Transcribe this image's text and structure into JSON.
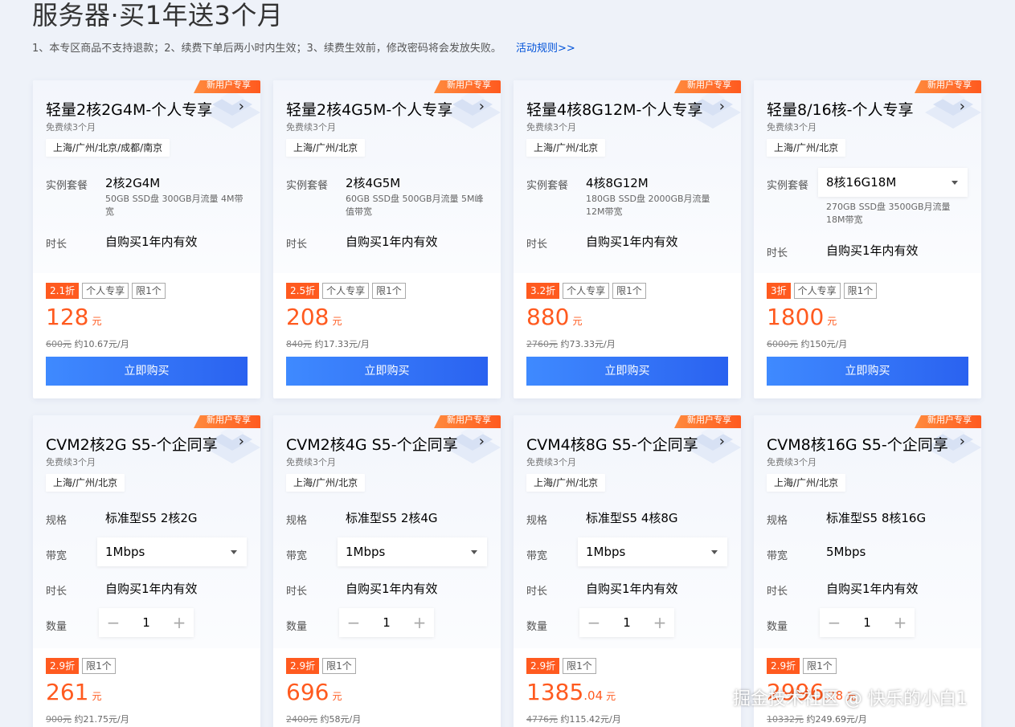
{
  "header": {
    "title": "服务器·买1年送3个月",
    "notice": "1、本专区商品不支持退款；2、续费下单后两小时内生效；3、续费生效前，修改密码将会发放失败。",
    "rules_link": "活动规则>>"
  },
  "cards": [
    {
      "badge": "新用户专享",
      "title": "轻量2核2G4M-个人专享",
      "subtitle": "免费续3个月",
      "region": "上海/广州/北京/成都/南京",
      "spec_label": "实例套餐",
      "spec_value": "2核2G4M",
      "spec_desc": "50GB SSD盘 300GB月流量 4M带宽",
      "duration_label": "时长",
      "duration_value": "自购买1年内有效",
      "tags": [
        "2.1折",
        "个人专享",
        "限1个"
      ],
      "price": "128",
      "price_cents": "",
      "price_unit": "元",
      "orig_price": "600元",
      "monthly": "约10.67元/月",
      "buy_label": "立即购买"
    },
    {
      "badge": "新用户专享",
      "title": "轻量2核4G5M-个人专享",
      "subtitle": "免费续3个月",
      "region": "上海/广州/北京",
      "spec_label": "实例套餐",
      "spec_value": "2核4G5M",
      "spec_desc": "60GB SSD盘 500GB月流量 5M峰值带宽",
      "duration_label": "时长",
      "duration_value": "自购买1年内有效",
      "tags": [
        "2.5折",
        "个人专享",
        "限1个"
      ],
      "price": "208",
      "price_cents": "",
      "price_unit": "元",
      "orig_price": "840元",
      "monthly": "约17.33元/月",
      "buy_label": "立即购买"
    },
    {
      "badge": "新用户专享",
      "title": "轻量4核8G12M-个人专享",
      "subtitle": "免费续3个月",
      "region": "上海/广州/北京",
      "spec_label": "实例套餐",
      "spec_value": "4核8G12M",
      "spec_desc": "180GB SSD盘 2000GB月流量 12M带宽",
      "duration_label": "时长",
      "duration_value": "自购买1年内有效",
      "tags": [
        "3.2折",
        "个人专享",
        "限1个"
      ],
      "price": "880",
      "price_cents": "",
      "price_unit": "元",
      "orig_price": "2760元",
      "monthly": "约73.33元/月",
      "buy_label": "立即购买"
    },
    {
      "badge": "新用户专享",
      "title": "轻量8/16核-个人专享",
      "subtitle": "免费续3个月",
      "region": "上海/广州/北京",
      "spec_label": "实例套餐",
      "spec_value": "8核16G18M",
      "spec_desc": "270GB SSD盘 3500GB月流量 18M带宽",
      "duration_label": "时长",
      "duration_value": "自购买1年内有效",
      "tags": [
        "3折",
        "个人专享",
        "限1个"
      ],
      "price": "1800",
      "price_cents": "",
      "price_unit": "元",
      "orig_price": "6000元",
      "monthly": "约150元/月",
      "buy_label": "立即购买"
    },
    {
      "badge": "新用户专享",
      "title": "CVM2核2G S5-个企同享",
      "subtitle": "免费续3个月",
      "region": "上海/广州/北京",
      "spec_label": "规格",
      "spec_value": "标准型S5 2核2G",
      "bw_label": "带宽",
      "bw_value": "1Mbps",
      "duration_label": "时长",
      "duration_value": "自购买1年内有效",
      "qty_label": "数量",
      "qty_value": "1",
      "qty_minus": "−",
      "qty_plus": "+",
      "tags": [
        "2.9折",
        "限1个"
      ],
      "price": "261",
      "price_cents": "",
      "price_unit": "元",
      "orig_price": "900元",
      "monthly": "约21.75元/月"
    },
    {
      "badge": "新用户专享",
      "title": "CVM2核4G S5-个企同享",
      "subtitle": "免费续3个月",
      "region": "上海/广州/北京",
      "spec_label": "规格",
      "spec_value": "标准型S5 2核4G",
      "bw_label": "带宽",
      "bw_value": "1Mbps",
      "duration_label": "时长",
      "duration_value": "自购买1年内有效",
      "qty_label": "数量",
      "qty_value": "1",
      "qty_minus": "−",
      "qty_plus": "+",
      "tags": [
        "2.9折",
        "限1个"
      ],
      "price": "696",
      "price_cents": "",
      "price_unit": "元",
      "orig_price": "2400元",
      "monthly": "约58元/月"
    },
    {
      "badge": "新用户专享",
      "title": "CVM4核8G S5-个企同享",
      "subtitle": "免费续3个月",
      "region": "上海/广州/北京",
      "spec_label": "规格",
      "spec_value": "标准型S5 4核8G",
      "bw_label": "带宽",
      "bw_value": "1Mbps",
      "duration_label": "时长",
      "duration_value": "自购买1年内有效",
      "qty_label": "数量",
      "qty_value": "1",
      "qty_minus": "−",
      "qty_plus": "+",
      "tags": [
        "2.9折",
        "限1个"
      ],
      "price": "1385",
      "price_cents": ".04",
      "price_unit": "元",
      "orig_price": "4776元",
      "monthly": "约115.42元/月"
    },
    {
      "badge": "新用户专享",
      "title": "CVM8核16G S5-个企同享",
      "subtitle": "免费续3个月",
      "region": "上海/广州/北京",
      "spec_label": "规格",
      "spec_value": "标准型S5 8核16G",
      "bw_label": "带宽",
      "bw_value": "5Mbps",
      "duration_label": "时长",
      "duration_value": "自购买1年内有效",
      "qty_label": "数量",
      "qty_value": "1",
      "qty_minus": "−",
      "qty_plus": "+",
      "tags": [
        "2.9折",
        "限1个"
      ],
      "price": "2996",
      "price_cents": ".28",
      "price_unit": "元",
      "orig_price": "10332元",
      "monthly": "约249.69元/月"
    }
  ],
  "watermark": "掘金技术社区 @ 快乐的小白1",
  "colors": {
    "accent": "#ff5a1f",
    "button": "#2a62f0",
    "link": "#0052d9",
    "background": "#eef2f9"
  }
}
